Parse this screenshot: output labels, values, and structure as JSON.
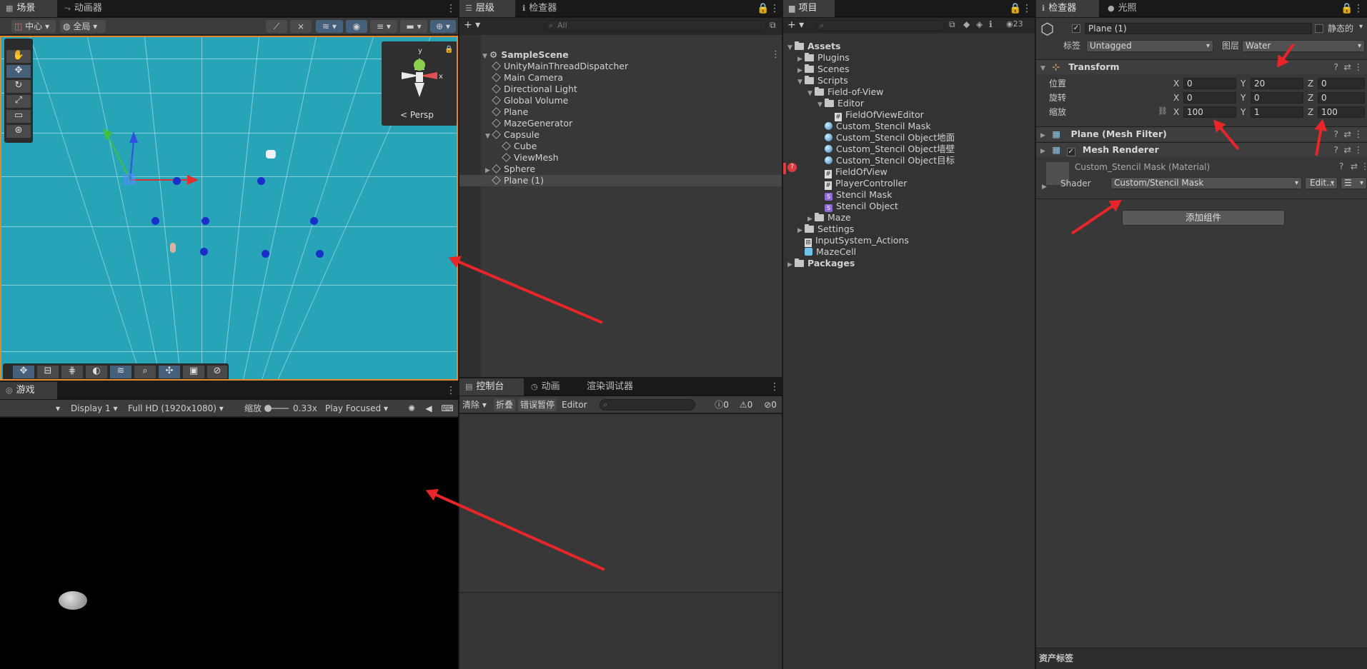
{
  "scene": {
    "tabs": [
      {
        "label": "场景",
        "icon": "grid-icon"
      },
      {
        "label": "动画器",
        "icon": "animator-icon"
      }
    ],
    "pivot_label": "中心",
    "space_label": "全局",
    "persp_label": "Persp",
    "gizmo_axes": {
      "y": "y",
      "x": "x"
    }
  },
  "game": {
    "tab": "游戏",
    "display": "Display 1",
    "resolution": "Full HD (1920x1080)",
    "scale_label": "缩放",
    "scale_value": "0.33x",
    "play_mode": "Play Focused"
  },
  "hierarchy": {
    "tabs": [
      "层级",
      "检查器"
    ],
    "search_placeholder": "All",
    "scene_name": "SampleScene",
    "items": [
      {
        "name": "UnityMainThreadDispatcher",
        "indent": 1
      },
      {
        "name": "Main Camera",
        "indent": 1
      },
      {
        "name": "Directional Light",
        "indent": 1
      },
      {
        "name": "Global Volume",
        "indent": 1
      },
      {
        "name": "Plane",
        "indent": 1
      },
      {
        "name": "MazeGenerator",
        "indent": 1
      },
      {
        "name": "Capsule",
        "indent": 1,
        "expanded": true
      },
      {
        "name": "Cube",
        "indent": 2
      },
      {
        "name": "ViewMesh",
        "indent": 2
      },
      {
        "name": "Sphere",
        "indent": 1,
        "collapsed": true
      },
      {
        "name": "Plane (1)",
        "indent": 1,
        "selected": true
      }
    ]
  },
  "console": {
    "tabs": [
      "控制台",
      "动画",
      "渲染调试器"
    ],
    "clear": "清除",
    "collapse": "折叠",
    "error_pause": "错误暂停",
    "editor": "Editor",
    "count_log": "0",
    "count_warn": "0",
    "count_error": "0"
  },
  "project": {
    "tab": "项目",
    "hidden_count": "23",
    "tree": [
      {
        "name": "Assets",
        "type": "folder",
        "indent": 0,
        "expanded": true
      },
      {
        "name": "Plugins",
        "type": "folder",
        "indent": 1
      },
      {
        "name": "Scenes",
        "type": "folder",
        "indent": 1
      },
      {
        "name": "Scripts",
        "type": "folder",
        "indent": 1,
        "expanded": true
      },
      {
        "name": "Field-of-View",
        "type": "folder",
        "indent": 2,
        "expanded": true
      },
      {
        "name": "Editor",
        "type": "folder",
        "indent": 3,
        "expanded": true
      },
      {
        "name": "FieldOfViewEditor",
        "type": "script",
        "indent": 4
      },
      {
        "name": "Custom_Stencil Mask",
        "type": "material",
        "indent": 3
      },
      {
        "name": "Custom_Stencil Object地面",
        "type": "material",
        "indent": 3
      },
      {
        "name": "Custom_Stencil Object墙壁",
        "type": "material",
        "indent": 3
      },
      {
        "name": "Custom_Stencil Object目标",
        "type": "material",
        "indent": 3
      },
      {
        "name": "FieldOfView",
        "type": "script",
        "indent": 3
      },
      {
        "name": "PlayerController",
        "type": "script",
        "indent": 3
      },
      {
        "name": "Stencil Mask",
        "type": "shader",
        "indent": 3
      },
      {
        "name": "Stencil Object",
        "type": "shader",
        "indent": 3
      },
      {
        "name": "Maze",
        "type": "folder",
        "indent": 2
      },
      {
        "name": "Settings",
        "type": "folder",
        "indent": 1
      },
      {
        "name": "InputSystem_Actions",
        "type": "input",
        "indent": 1
      },
      {
        "name": "MazeCell",
        "type": "prefab",
        "indent": 1
      },
      {
        "name": "Packages",
        "type": "folder",
        "indent": 0
      }
    ]
  },
  "inspector": {
    "tabs": [
      "检查器",
      "光照"
    ],
    "object_name": "Plane (1)",
    "static_label": "静态的",
    "tag_label": "标签",
    "tag_value": "Untagged",
    "layer_label": "图层",
    "layer_value": "Water",
    "transform_title": "Transform",
    "position_label": "位置",
    "rotation_label": "旋转",
    "scale_label": "缩放",
    "position": {
      "x": "0",
      "y": "20",
      "z": "0"
    },
    "rotation": {
      "x": "0",
      "y": "0",
      "z": "0"
    },
    "scale": {
      "x": "100",
      "y": "1",
      "z": "100"
    },
    "axis": {
      "x": "X",
      "y": "Y",
      "z": "Z"
    },
    "mesh_filter_title": "Plane (Mesh Filter)",
    "mesh_renderer_title": "Mesh Renderer",
    "material_name": "Custom_Stencil Mask (Material)",
    "shader_label": "Shader",
    "shader_value": "Custom/Stencil Mask",
    "edit_label": "Edit...",
    "add_component": "添加组件",
    "asset_labels": "资产标签"
  },
  "colors": {
    "accent": "#46607c",
    "annotation": "#e8262a",
    "ground": "#27a4b8"
  }
}
